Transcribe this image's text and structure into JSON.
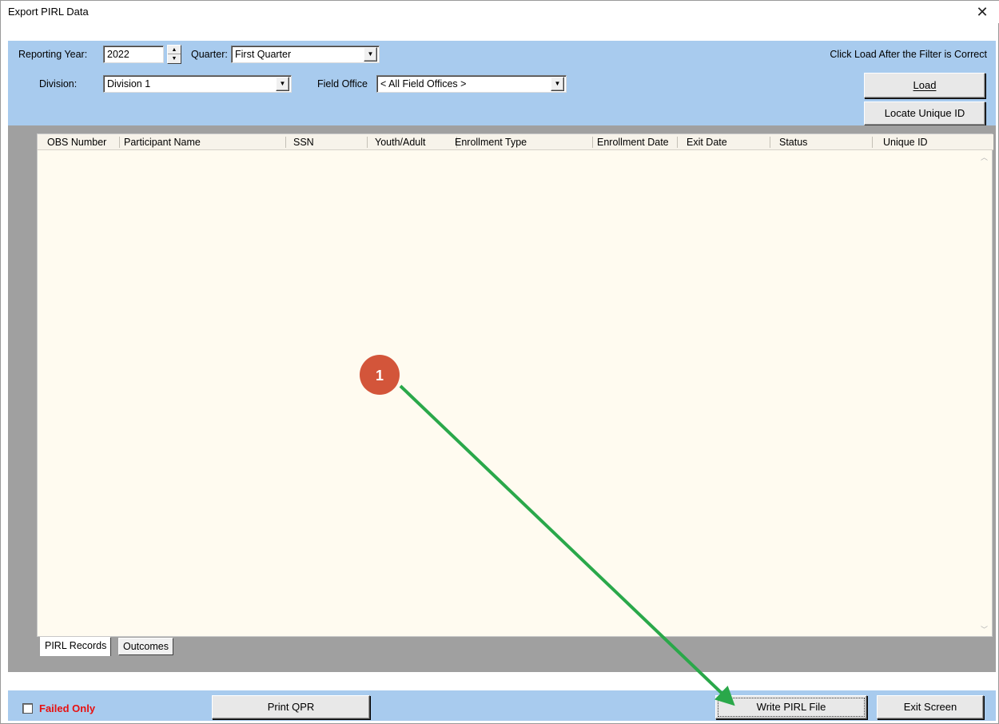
{
  "window": {
    "title": "Export PIRL Data",
    "close_glyph": "✕"
  },
  "filters": {
    "reporting_year_label": "Reporting Year:",
    "reporting_year_value": "2022",
    "quarter_label": "Quarter:",
    "quarter_value": "First Quarter",
    "division_label": "Division:",
    "division_value": "Division 1",
    "field_office_label": "Field Office",
    "field_office_value": "< All Field Offices >",
    "hint_text": "Click Load After the Filter is Correct"
  },
  "buttons": {
    "load": "Load",
    "locate_unique_id": "Locate Unique ID",
    "print_qpr": "Print QPR",
    "write_pirl_file": "Write PIRL File",
    "exit_screen": "Exit Screen"
  },
  "grid": {
    "columns": [
      "OBS Number",
      "Participant Name",
      "SSN",
      "Youth/Adult",
      "Enrollment Type",
      "Enrollment Date",
      "Exit Date",
      "Status",
      "Unique ID"
    ],
    "rows": []
  },
  "tabs": [
    "PIRL Records",
    "Outcomes"
  ],
  "bottom": {
    "failed_only_label": "Failed Only",
    "failed_only_checked": false
  },
  "annotation": {
    "step_number": "1",
    "marker_color": "#d3553a",
    "arrow_color": "#2aa84a"
  },
  "colors": {
    "panel_bg": "#a8cbee",
    "grid_bg": "#fffbf0",
    "failed_text": "#e81010"
  },
  "icons": [
    "close-icon",
    "spin-up-icon",
    "spin-down-icon",
    "dropdown-arrow-icon",
    "scroll-up-icon",
    "scroll-down-icon"
  ]
}
